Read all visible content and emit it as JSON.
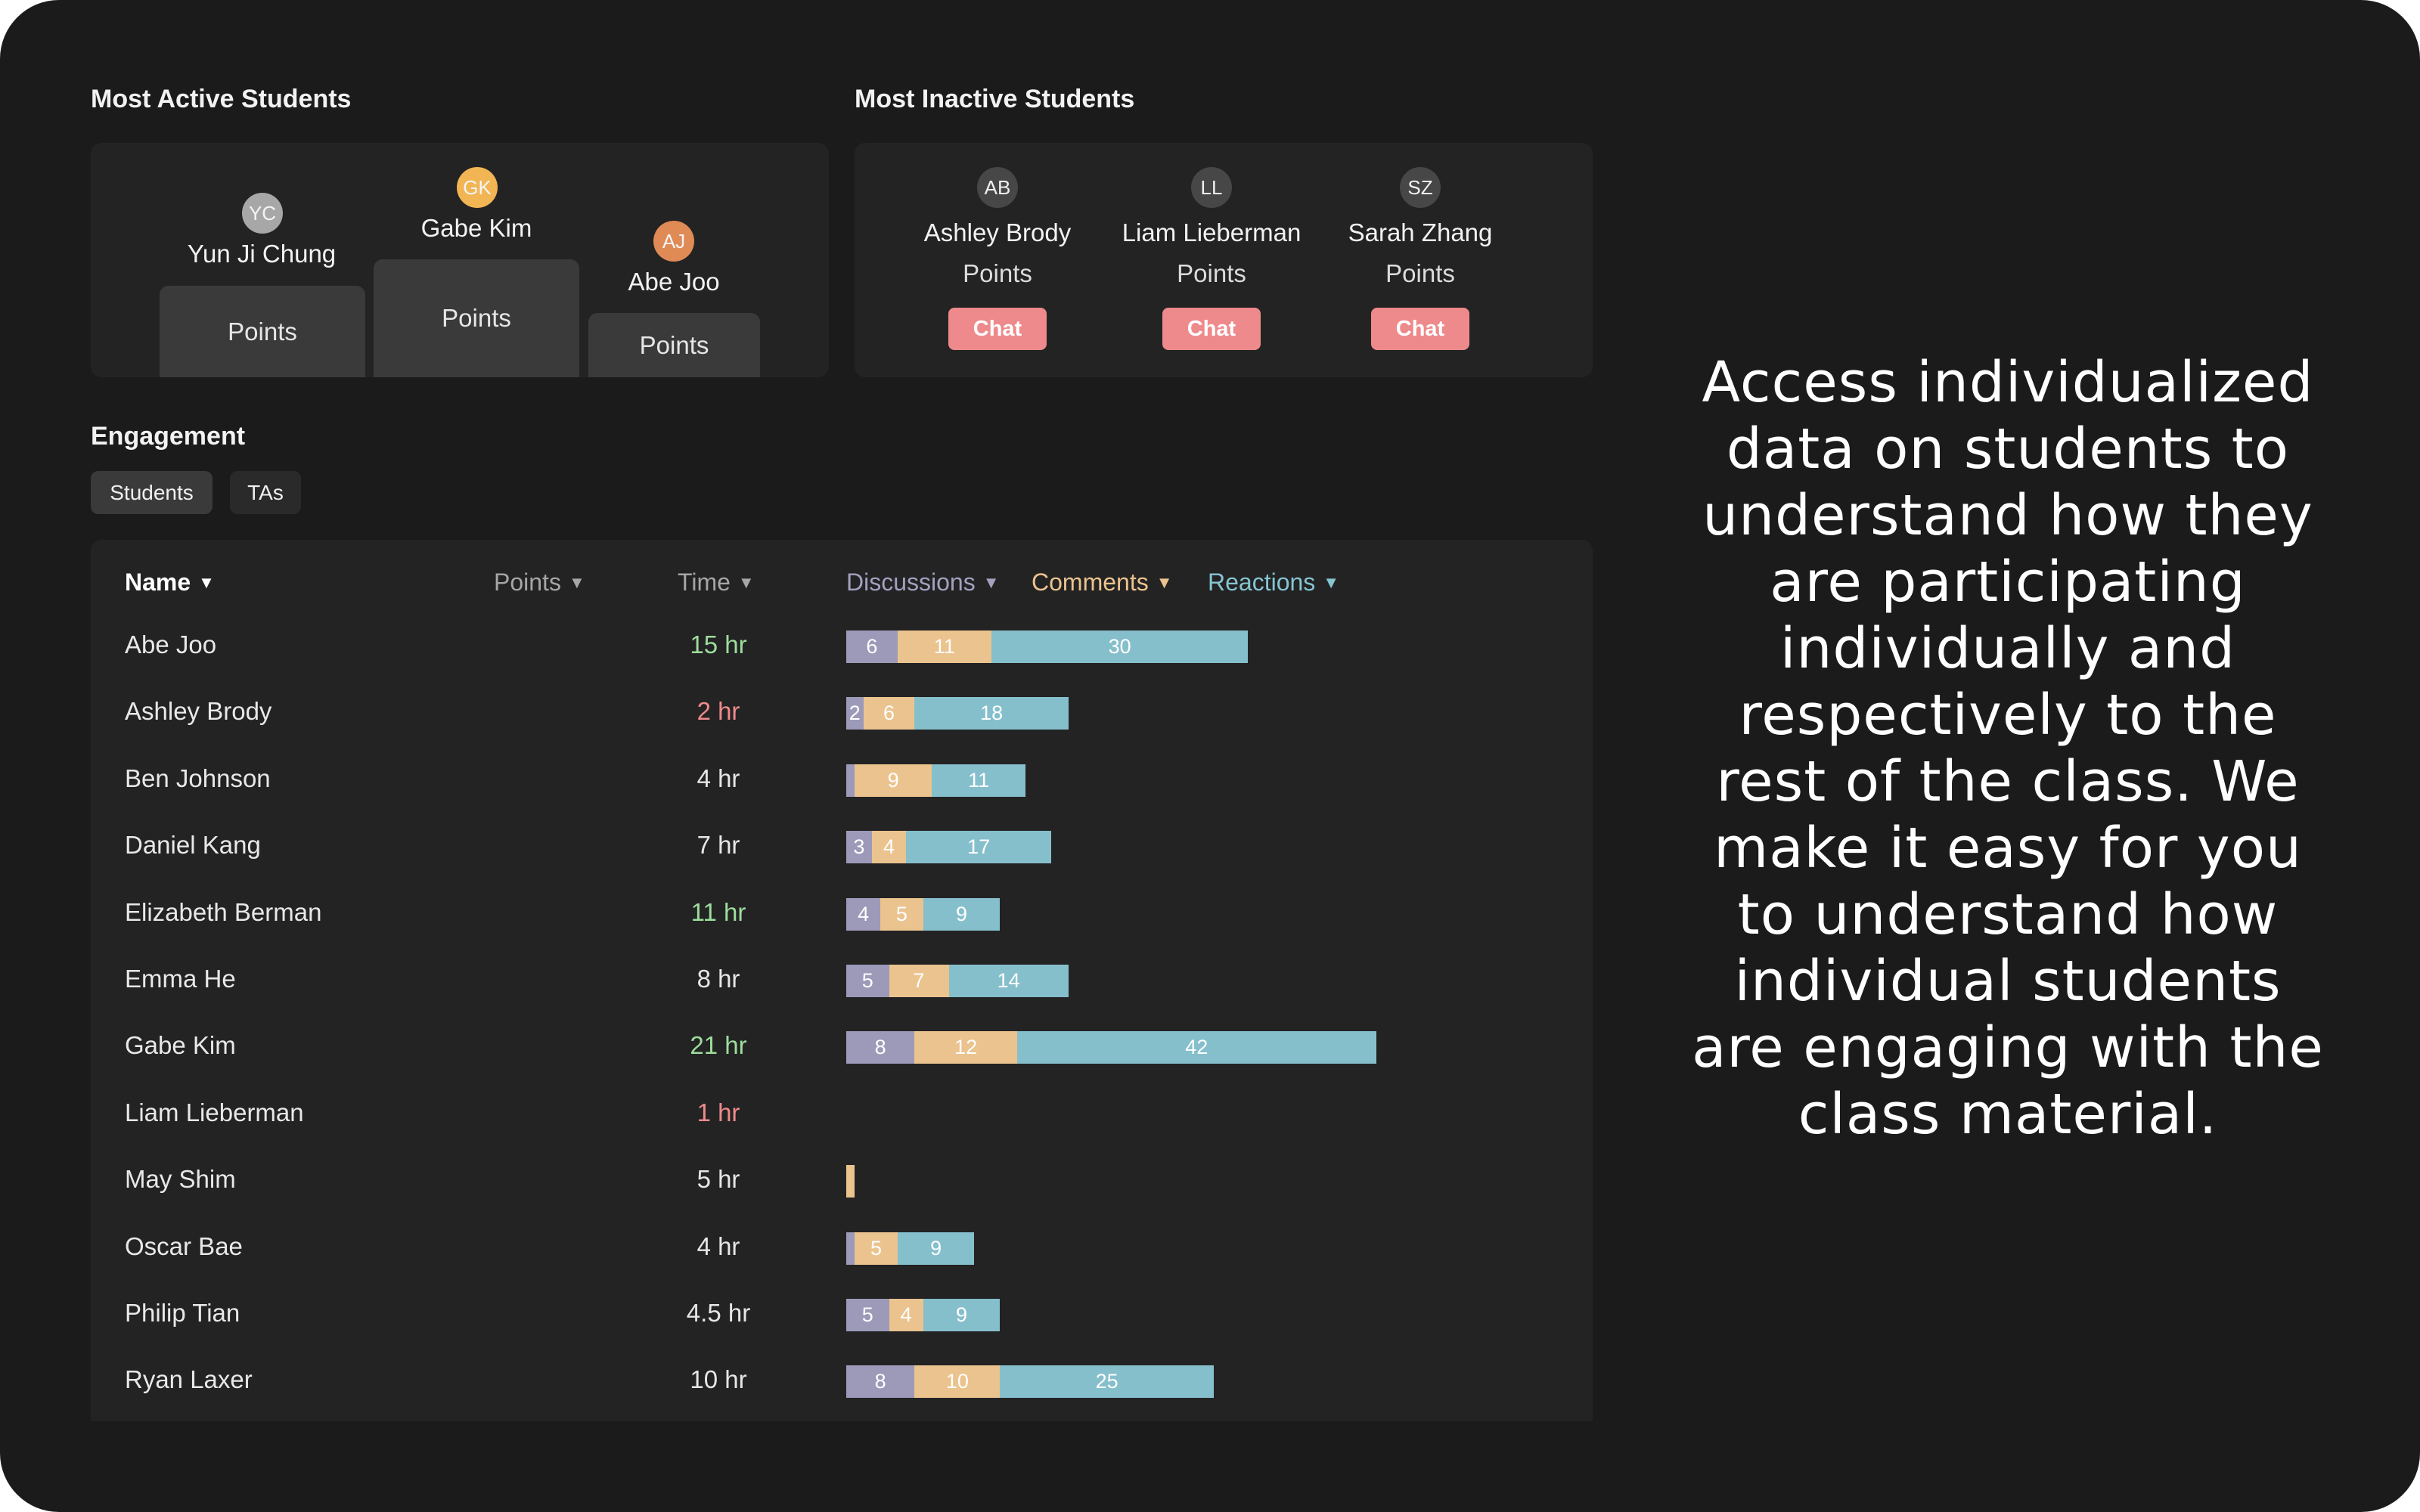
{
  "active": {
    "title": "Most Active Students",
    "podium": [
      {
        "name": "Yun Ji Chung",
        "initials": "YC",
        "label": "Points",
        "avatar_color": "#a7a7a8",
        "rank": 2
      },
      {
        "name": "Gabe Kim",
        "initials": "GK",
        "label": "Points",
        "avatar_color": "#f2b553",
        "rank": 1
      },
      {
        "name": "Abe Joo",
        "initials": "AJ",
        "label": "Points",
        "avatar_color": "#e08a55",
        "rank": 3
      }
    ]
  },
  "inactive": {
    "title": "Most Inactive Students",
    "students": [
      {
        "name": "Ashley Brody",
        "initials": "AB",
        "label": "Points",
        "chat": "Chat"
      },
      {
        "name": "Liam Lieberman",
        "initials": "LL",
        "label": "Points",
        "chat": "Chat"
      },
      {
        "name": "Sarah Zhang",
        "initials": "SZ",
        "label": "Points",
        "chat": "Chat"
      }
    ]
  },
  "engagement": {
    "title": "Engagement",
    "tabs": [
      {
        "label": "Students",
        "active": true
      },
      {
        "label": "TAs",
        "active": false
      }
    ],
    "columns": {
      "name": "Name",
      "points": "Points",
      "time": "Time",
      "discussions": "Discussions",
      "comments": "Comments",
      "reactions": "Reactions"
    },
    "colors": {
      "discussions": "#9c9ab8",
      "comments": "#ebc38e",
      "reactions": "#86bfcc",
      "time_high": "#9ddd9c",
      "time_low": "#ef8b8b",
      "time_normal": "#e6e6e6"
    },
    "rows": [
      {
        "name": "Abe Joo",
        "time": "15 hr",
        "time_status": "high",
        "discussions": 6,
        "comments": 11,
        "reactions": 30
      },
      {
        "name": "Ashley Brody",
        "time": "2 hr",
        "time_status": "low",
        "discussions": 2,
        "comments": 6,
        "reactions": 18
      },
      {
        "name": "Ben Johnson",
        "time": "4 hr",
        "time_status": "normal",
        "discussions": 1,
        "comments": 9,
        "reactions": 11,
        "hide_label": [
          "discussions"
        ]
      },
      {
        "name": "Daniel Kang",
        "time": "7 hr",
        "time_status": "normal",
        "discussions": 3,
        "comments": 4,
        "reactions": 17
      },
      {
        "name": "Elizabeth Berman",
        "time": "11 hr",
        "time_status": "high",
        "discussions": 4,
        "comments": 5,
        "reactions": 9
      },
      {
        "name": "Emma He",
        "time": "8 hr",
        "time_status": "normal",
        "discussions": 5,
        "comments": 7,
        "reactions": 14
      },
      {
        "name": "Gabe Kim",
        "time": "21 hr",
        "time_status": "high",
        "discussions": 8,
        "comments": 12,
        "reactions": 42
      },
      {
        "name": "Liam Lieberman",
        "time": "1 hr",
        "time_status": "low",
        "discussions": 0,
        "comments": 0,
        "reactions": 0
      },
      {
        "name": "May Shim",
        "time": "5 hr",
        "time_status": "normal",
        "discussions": 0,
        "comments": 1,
        "reactions": 0,
        "hide_label": [
          "comments"
        ]
      },
      {
        "name": "Oscar Bae",
        "time": "4 hr",
        "time_status": "normal",
        "discussions": 1,
        "comments": 5,
        "reactions": 9,
        "hide_label": [
          "discussions"
        ]
      },
      {
        "name": "Philip Tian",
        "time": "4.5 hr",
        "time_status": "normal",
        "discussions": 5,
        "comments": 4,
        "reactions": 9
      },
      {
        "name": "Ryan Laxer",
        "time": "10 hr",
        "time_status": "normal",
        "discussions": 8,
        "comments": 10,
        "reactions": 25
      }
    ]
  },
  "description": "Access individualized data on students to understand how they are participating individually and respectively to the rest of the class. We make it easy for you to understand how individual students are engaging with the class material."
}
